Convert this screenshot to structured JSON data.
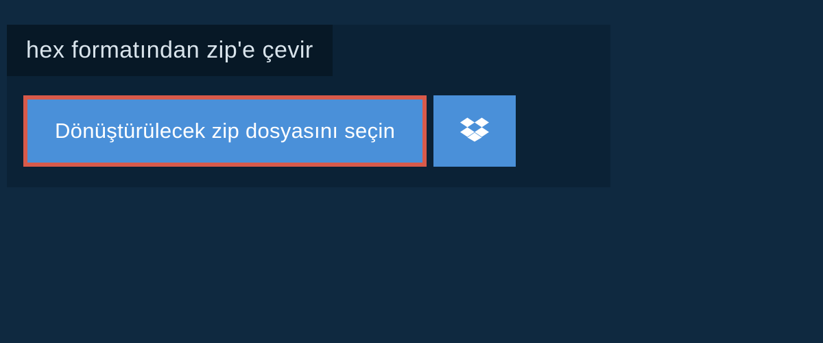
{
  "header": {
    "tab_label": "hex formatından zip'e çevir"
  },
  "actions": {
    "select_file_label": "Dönüştürülecek zip dosyasını seçin",
    "dropbox_icon": "dropbox-icon"
  },
  "colors": {
    "page_bg": "#0f2940",
    "panel_bg": "#0b2236",
    "tab_bg": "#071826",
    "button_bg": "#4a90d9",
    "button_border": "#d85a4a",
    "text_light": "#ffffff",
    "text_muted": "#d9e4ec"
  }
}
